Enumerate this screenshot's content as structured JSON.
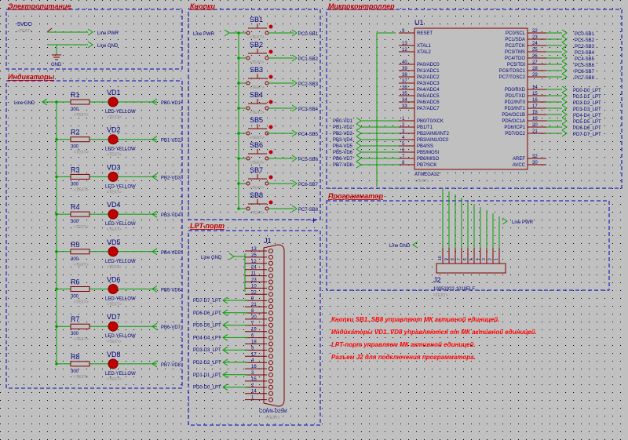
{
  "sections": {
    "power": "Электропитание",
    "indicators": "Индикаторы",
    "buttons": "Кнопки",
    "mcu": "Микроконтроллер",
    "lpt": "LPT-порт",
    "programmer": "Программатор"
  },
  "text_placeholder": "<TEXT>",
  "power": {
    "supply": "5VDC",
    "gnd": "GND",
    "line_pwr": "Line PWR",
    "line_gnd": "Line GND"
  },
  "indicators": {
    "line_gnd": "Line GND",
    "resistor_value": "300",
    "led_type": "LED-YELLOW",
    "rows": [
      {
        "r": "R1",
        "vd": "VD1",
        "out": "PB0-VD1"
      },
      {
        "r": "R2",
        "vd": "VD2",
        "out": "PB1-VD2"
      },
      {
        "r": "R3",
        "vd": "VD3",
        "out": "PB2-VD3"
      },
      {
        "r": "R4",
        "vd": "VD4",
        "out": "PB3-VD4"
      },
      {
        "r": "R5",
        "vd": "VD5",
        "out": "PB4-VD5"
      },
      {
        "r": "R6",
        "vd": "VD6",
        "out": "PB5-VD6"
      },
      {
        "r": "R7",
        "vd": "VD7",
        "out": "PB6-VD7"
      },
      {
        "r": "R8",
        "vd": "VD8",
        "out": "PB7-VD8"
      }
    ]
  },
  "buttons": {
    "line_pwr": "Line PWR",
    "rows": [
      {
        "sb": "SB1",
        "out": "PC0-SB1"
      },
      {
        "sb": "SB2",
        "out": "PC1-SB2"
      },
      {
        "sb": "SB3",
        "out": "PC2-SB3"
      },
      {
        "sb": "SB4",
        "out": "PC3-SB4"
      },
      {
        "sb": "SB5",
        "out": "PC4-SB5"
      },
      {
        "sb": "SB6",
        "out": "PC5-SB6"
      },
      {
        "sb": "SB7",
        "out": "PC6-SB7"
      },
      {
        "sb": "SB8",
        "out": "PC7-SB8"
      }
    ]
  },
  "mcu": {
    "ref": "U1",
    "part": "ATMEGA32",
    "left_pins": [
      {
        "num": "9",
        "name": "RESET"
      },
      {
        "num": "13",
        "name": "XTAL1"
      },
      {
        "num": "12",
        "name": "XTAL2"
      },
      {
        "num": "40",
        "name": "PA0/ADC0"
      },
      {
        "num": "39",
        "name": "PA1/ADC1"
      },
      {
        "num": "38",
        "name": "PA2/ADC2"
      },
      {
        "num": "37",
        "name": "PA3/ADC3"
      },
      {
        "num": "36",
        "name": "PA4/ADC4"
      },
      {
        "num": "35",
        "name": "PA5/ADC5"
      },
      {
        "num": "34",
        "name": "PA6/ADC6"
      },
      {
        "num": "33",
        "name": "PA7/ADC7"
      },
      {
        "num": "1",
        "name": "PB0/T0/XCK"
      },
      {
        "num": "2",
        "name": "PB1/T1"
      },
      {
        "num": "3",
        "name": "PB2/AIN0/INT2"
      },
      {
        "num": "4",
        "name": "PB3/AIN1/OC0"
      },
      {
        "num": "5",
        "name": "PB4/SS"
      },
      {
        "num": "6",
        "name": "PB5/MOSI"
      },
      {
        "num": "7",
        "name": "PB6/MISO"
      },
      {
        "num": "8",
        "name": "PB7/SCK"
      }
    ],
    "right_pins_c": [
      {
        "num": "22",
        "name": "PC0/SCL",
        "net": "PC0-SB1"
      },
      {
        "num": "23",
        "name": "PC1/SDA",
        "net": "PC1-SB2"
      },
      {
        "num": "24",
        "name": "PC2/TCK",
        "net": "PC2-SB3"
      },
      {
        "num": "25",
        "name": "PC3/TMS",
        "net": "PC3-SB4"
      },
      {
        "num": "26",
        "name": "PC4/TDO",
        "net": "PC4-SB5"
      },
      {
        "num": "27",
        "name": "PC5/TDI",
        "net": "PC5-SB6"
      },
      {
        "num": "28",
        "name": "PC6/TOSC1",
        "net": "PC6-SB7"
      },
      {
        "num": "29",
        "name": "PC7/TOSC2",
        "net": "PC7-SB8"
      }
    ],
    "right_pins_d": [
      {
        "num": "14",
        "name": "PD0/RXD",
        "net": "PD0-D0_LPT"
      },
      {
        "num": "15",
        "name": "PD1/TXD",
        "net": "PD1-D1_LPT"
      },
      {
        "num": "16",
        "name": "PD2/INT0",
        "net": "PD2-D2_LPT"
      },
      {
        "num": "17",
        "name": "PD3/INT1",
        "net": "PD3-D3_LPT"
      },
      {
        "num": "18",
        "name": "PD4/OC1B",
        "net": "PD4-D4_LPT"
      },
      {
        "num": "19",
        "name": "PD5/OC1A",
        "net": "PD5-D5_LPT"
      },
      {
        "num": "20",
        "name": "PD6/ICP1",
        "net": "PD6-D6_LPT"
      },
      {
        "num": "21",
        "name": "PD7/OC2",
        "net": "PD7-D7_LPT"
      }
    ],
    "right_pins_other": [
      {
        "num": "32",
        "name": "AREF"
      },
      {
        "num": "30",
        "name": "AVCC"
      }
    ],
    "pb_nets": [
      "PB0-VD1",
      "PB1-VD2",
      "PB2-VD3",
      "PB3-VD4",
      "PB4-VD5",
      "PB5-VD6",
      "PB6-VD7",
      "PB7-VD8"
    ]
  },
  "lpt": {
    "ref": "J1",
    "part": "CONN-D25M",
    "line_gnd": "Line GND",
    "pins": [
      "13",
      "25",
      "12",
      "24",
      "11",
      "23",
      "10",
      "22",
      "9",
      "21",
      "8",
      "20",
      "7",
      "19",
      "6",
      "18",
      "5",
      "17",
      "4",
      "16",
      "3",
      "15",
      "2",
      "14",
      "1"
    ],
    "nets": [
      "PD7-D7_LPT",
      "PD6-D6_LPT",
      "PD5-D5_LPT",
      "PD4-D4_LPT",
      "PD3-D3_LPT",
      "PD2-D2_LPT",
      "PD1-D1_LPT",
      "PD0-D0_LPT"
    ]
  },
  "programmer": {
    "ref": "J2",
    "part": "10051922-1010ELF",
    "line_pwr": "Line PWR",
    "line_gnd": "Line GND",
    "pins": [
      "10",
      "9",
      "8",
      "7",
      "6",
      "5",
      "4",
      "3",
      "2",
      "1"
    ]
  },
  "notes": [
    "Кнопки SB1..SB8 управляют МК активной единицей.",
    "Индикаторы VD1..VD8 управляются от МК активной единицей.",
    "LPT-порт управляем МК активной единицей.",
    "Разъем J2 для подключения программатора."
  ],
  "colors": {
    "background": "#c0c0c0",
    "wire": "#00a000",
    "component": "#800000",
    "text": "#000080",
    "section_title": "#c00000",
    "frame": "#0000c0",
    "note": "#ff0000",
    "led": "#c00000"
  }
}
